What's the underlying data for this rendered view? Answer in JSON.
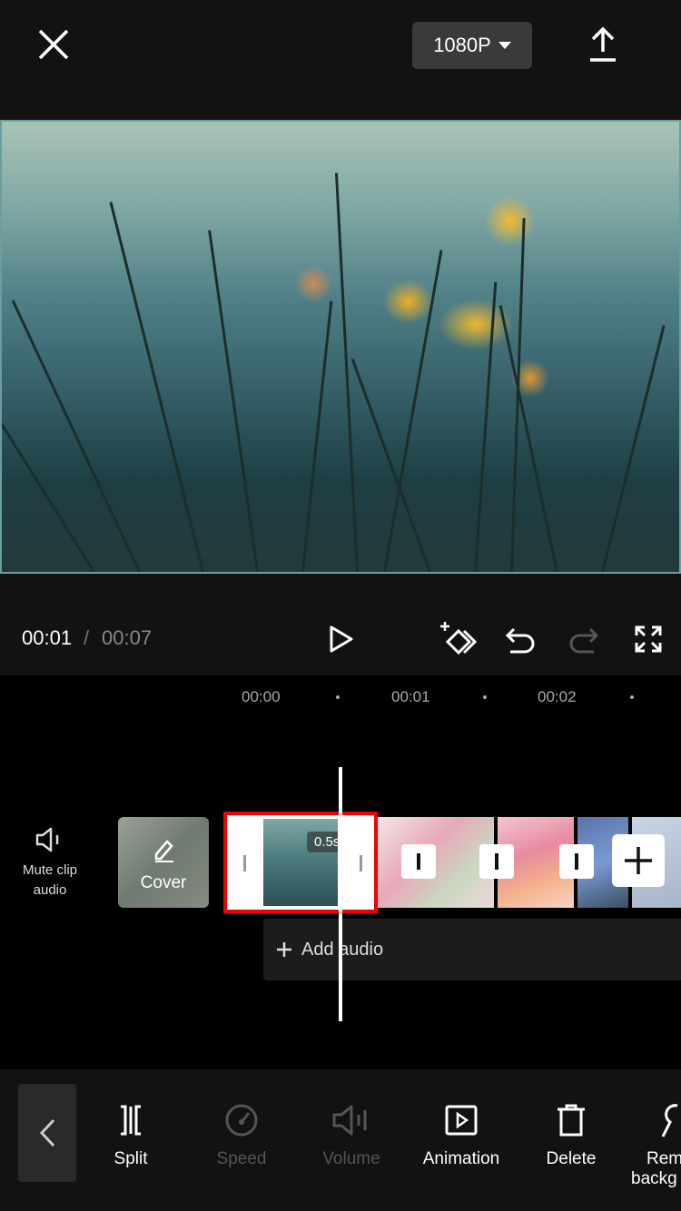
{
  "header": {
    "resolution": "1080P"
  },
  "player": {
    "current_time": "00:01",
    "separator": "/",
    "total_time": "00:07"
  },
  "ruler": {
    "marks": [
      "00:00",
      "00:01",
      "00:02"
    ]
  },
  "timeline": {
    "mute_label_line1": "Mute clip",
    "mute_label_line2": "audio",
    "cover_label": "Cover",
    "clip_duration": "0.5s",
    "add_audio_label": "Add audio"
  },
  "toolbar": {
    "split": "Split",
    "speed": "Speed",
    "volume": "Volume",
    "animation": "Animation",
    "delete": "Delete",
    "remove_bg_line1": "Rem",
    "remove_bg_line2": "backg"
  },
  "colors": {
    "selection": "#ee0000",
    "background": "#121212",
    "disabled": "#555555"
  }
}
